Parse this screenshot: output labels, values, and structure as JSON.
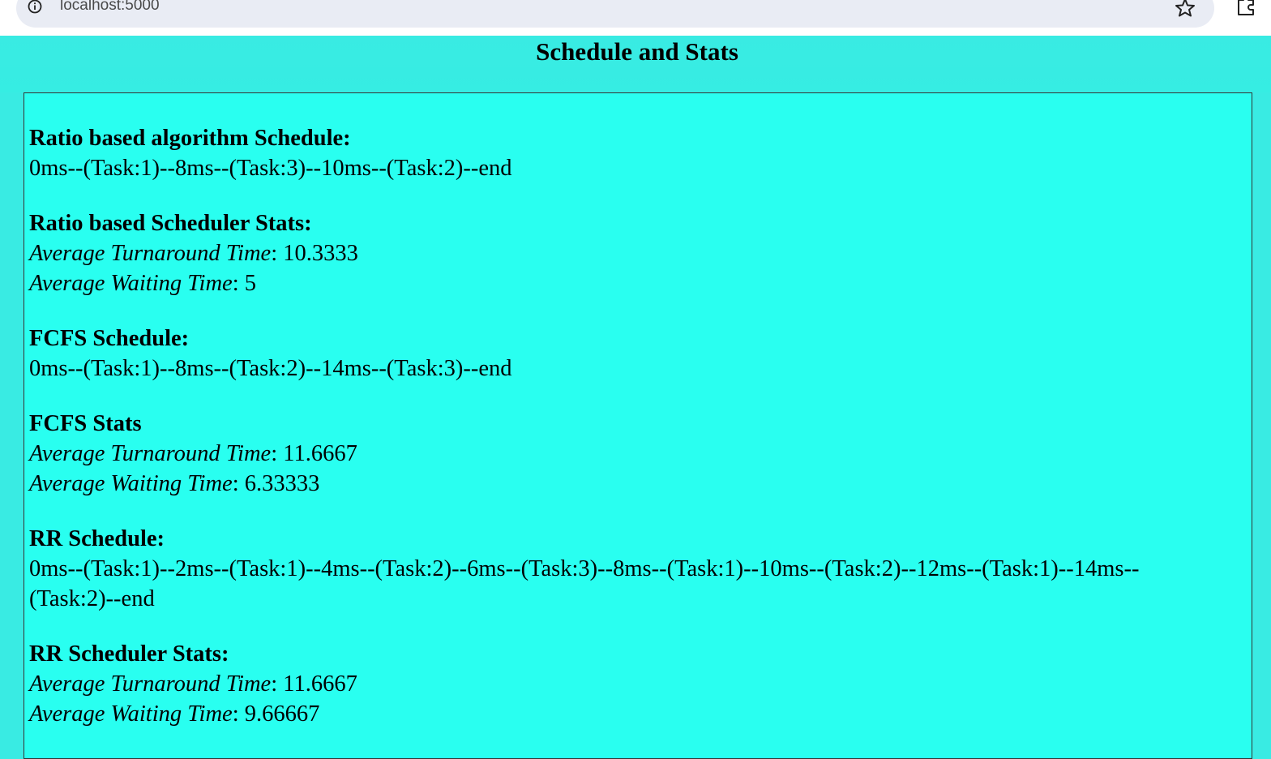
{
  "browser": {
    "url": "localhost:5000",
    "icons": [
      "info-icon",
      "star-icon",
      "extension-icon"
    ]
  },
  "page": {
    "title": "Schedule and Stats",
    "colors": {
      "background": "#39ebe3",
      "content_background": "#29fff0",
      "text": "#000000"
    }
  },
  "ratio": {
    "schedule_heading": "Ratio based algorithm Schedule:",
    "schedule": "0ms--(Task:1)--8ms--(Task:3)--10ms--(Task:2)--end",
    "stats_heading": "Ratio based Scheduler Stats:",
    "turnaround_label": "Average Turnaround Time",
    "turnaround_value": ": 10.3333",
    "waiting_label": "Average Waiting Time",
    "waiting_value": ": 5"
  },
  "fcfs": {
    "schedule_heading": "FCFS Schedule:",
    "schedule": "0ms--(Task:1)--8ms--(Task:2)--14ms--(Task:3)--end",
    "stats_heading": "FCFS Stats",
    "turnaround_label": "Average Turnaround Time",
    "turnaround_value": ": 11.6667",
    "waiting_label": "Average Waiting Time",
    "waiting_value": ": 6.33333"
  },
  "rr": {
    "schedule_heading": "RR Schedule:",
    "schedule_line1": "0ms--(Task:1)--2ms--(Task:1)--4ms--(Task:2)--6ms--(Task:3)--8ms--(Task:1)--10ms--(Task:2)--12ms--(Task:1)--14ms--",
    "schedule_line2": "(Task:2)--end",
    "stats_heading": "RR Scheduler Stats:",
    "turnaround_label": "Average Turnaround Time",
    "turnaround_value": ": 11.6667",
    "waiting_label": "Average Waiting Time",
    "waiting_value": ": 9.66667"
  }
}
